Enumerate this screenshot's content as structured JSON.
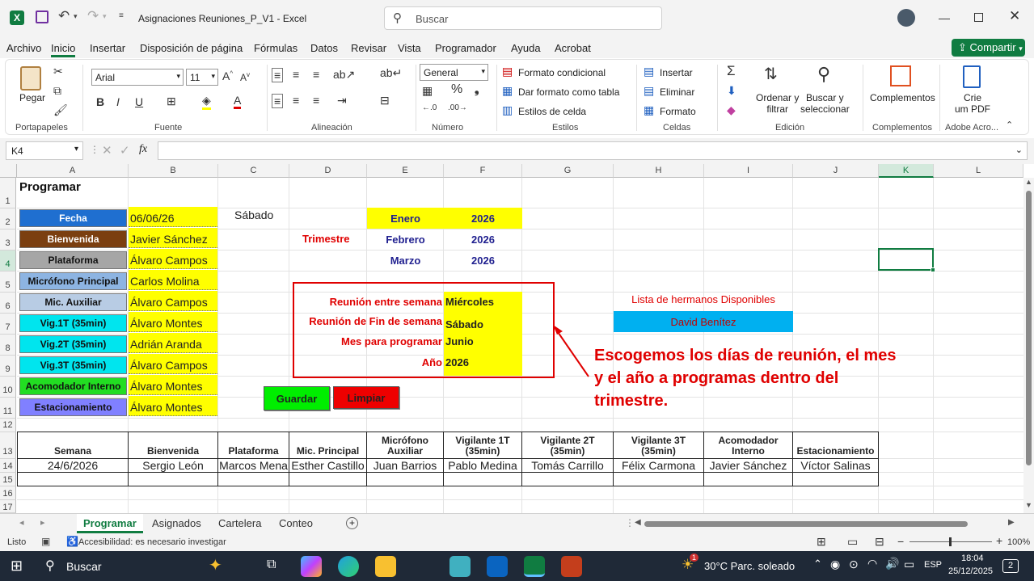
{
  "titlebar": {
    "app_icon": "excel-icon",
    "filename": "Asignaciones Reuniones_P_V1",
    "separator": "-",
    "app_name": "Excel",
    "search_placeholder": "Buscar"
  },
  "menu": {
    "items": [
      "Archivo",
      "Inicio",
      "Insertar",
      "Disposición de página",
      "Fórmulas",
      "Datos",
      "Revisar",
      "Vista",
      "Programador",
      "Ayuda",
      "Acrobat"
    ],
    "active": "Inicio",
    "share_label": "Compartir"
  },
  "ribbon": {
    "paste_label": "Pegar",
    "font_name": "Arial",
    "font_size": "11",
    "number_format": "General",
    "cond_format": "Formato condicional",
    "table_format": "Dar formato como tabla",
    "cell_styles": "Estilos de celda",
    "insert": "Insertar",
    "delete": "Eliminar",
    "format": "Formato",
    "sort_line1": "Ordenar y",
    "sort_line2": "filtrar",
    "find_line1": "Buscar y",
    "find_line2": "seleccionar",
    "addins": "Complementos",
    "pdf_line1": "Crie",
    "pdf_line2": "um PDF",
    "groups": [
      "Portapapeles",
      "Fuente",
      "Alineación",
      "Número",
      "Estilos",
      "Celdas",
      "Edición",
      "Complementos",
      "Adobe Acro..."
    ]
  },
  "formula_bar": {
    "name_box": "K4",
    "fx": "fx",
    "content": ""
  },
  "columns": [
    "A",
    "B",
    "C",
    "D",
    "E",
    "F",
    "G",
    "H",
    "I",
    "J",
    "K",
    "L"
  ],
  "rows": [
    "1",
    "2",
    "3",
    "4",
    "5",
    "6",
    "7",
    "8",
    "9",
    "10",
    "11",
    "12",
    "13",
    "14",
    "15",
    "16",
    "17"
  ],
  "sheet": {
    "title": "Programar",
    "roles": [
      {
        "label": "Fecha",
        "value": "06/06/26",
        "color": "#1f6fd0",
        "text": "#ffffff"
      },
      {
        "label": "Bienvenida",
        "value": "Javier Sánchez",
        "color": "#7b3f10",
        "text": "#ffffff"
      },
      {
        "label": "Plataforma",
        "value": "Álvaro Campos",
        "color": "#a6a6a6",
        "text": "#111111"
      },
      {
        "label": "Micrófono Principal",
        "value": "Carlos Molina",
        "color": "#8db4e2",
        "text": "#111111"
      },
      {
        "label": "Mic. Auxiliar",
        "value": "Álvaro Campos",
        "color": "#b8cce4",
        "text": "#111111"
      },
      {
        "label": "Vig.1T (35min)",
        "value": "Álvaro Montes",
        "color": "#00e5ee",
        "text": "#111111"
      },
      {
        "label": "Vig.2T (35min)",
        "value": "Adrián Aranda",
        "color": "#00e5ee",
        "text": "#111111"
      },
      {
        "label": "Vig.3T (35min)",
        "value": "Álvaro Campos",
        "color": "#00e5ee",
        "text": "#111111"
      },
      {
        "label": "Acomodador Interno",
        "value": "Álvaro Montes",
        "color": "#22dd22",
        "text": "#111111"
      },
      {
        "label": "Estacionamiento",
        "value": "Álvaro Montes",
        "color": "#8080ff",
        "text": "#111111"
      }
    ],
    "day_name": "Sábado",
    "trimestre_label": "Trimestre",
    "months": [
      {
        "month": "Enero",
        "year": "2026"
      },
      {
        "month": "Febrero",
        "year": "2026"
      },
      {
        "month": "Marzo",
        "year": "2026"
      }
    ],
    "settings": [
      {
        "label": "Reunión entre semana",
        "value": "Miércoles"
      },
      {
        "label": "Reunión de Fin de semana",
        "value": "Sábado"
      },
      {
        "label": "Mes para programar",
        "value": "Junio"
      },
      {
        "label": "Año",
        "value": "2026"
      }
    ],
    "available_title": "Lista de hermanos Disponibles",
    "available_name": "David Benítez",
    "save_button": "Guardar",
    "clear_button": "Limpiar",
    "annotation": "Escogemos los días de reunión, el mes y el año a programas dentro del trimestre.",
    "table_headers": [
      "Semana",
      "Bienvenida",
      "Plataforma",
      "Mic. Principal",
      "Micrófono Auxiliar",
      "Vigilante 1T (35min)",
      "Vigilante 2T (35min)",
      "Vigilante 3T (35min)",
      "Acomodador Interno",
      "Estacionamiento"
    ],
    "table_rows": [
      [
        "24/6/2026",
        "Sergio León",
        "Marcos Mena",
        "Esther Castillo",
        "Juan Barrios",
        "Pablo Medina",
        "Tomás Carrillo",
        "Félix Carmona",
        "Javier Sánchez",
        "Víctor Salinas"
      ]
    ]
  },
  "tabs": {
    "items": [
      "Programar",
      "Asignados",
      "Cartelera",
      "Conteo"
    ],
    "active": "Programar"
  },
  "status": {
    "ready": "Listo",
    "accessibility": "Accesibilidad: es necesario investigar",
    "zoom": "100%"
  },
  "taskbar": {
    "search": "Buscar",
    "weather": "30°C  Parc. soleado",
    "lang": "ESP",
    "time": "18:04",
    "date": "25/12/2025",
    "notif_count": "2",
    "weather_badge": "1"
  }
}
